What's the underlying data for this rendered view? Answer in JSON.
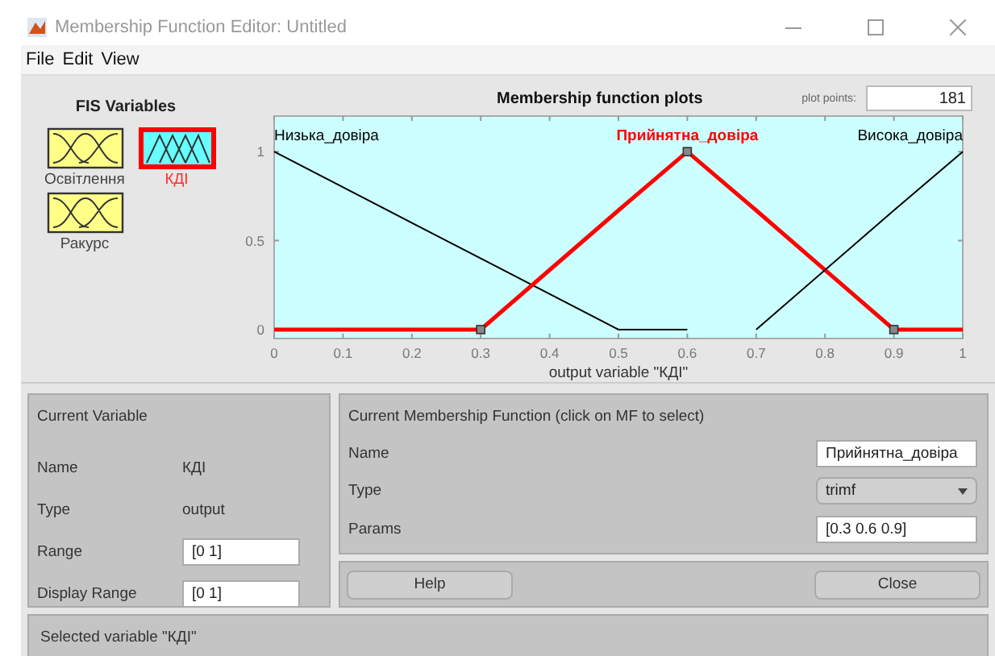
{
  "window": {
    "title": "Membership Function Editor: Untitled"
  },
  "menu": [
    "File",
    "Edit",
    "View"
  ],
  "fis_variables": {
    "title": "FIS Variables",
    "items": [
      {
        "name": "Освітлення",
        "kind": "input",
        "selected": false
      },
      {
        "name": "КДІ",
        "kind": "output",
        "selected": true
      },
      {
        "name": "Ракурс",
        "kind": "input",
        "selected": false
      }
    ]
  },
  "plot": {
    "title": "Membership function plots",
    "mf_states": [
      {
        "selected": false
      },
      {
        "selected": true
      },
      {
        "selected": false
      }
    ],
    "plot_points_label": "plot points:",
    "plot_points": "181",
    "chart_data": {
      "type": "line",
      "xlabel": "output variable \"КДІ\"",
      "x": [
        0,
        0.3,
        0.5,
        0.6,
        0.7,
        0.9,
        1
      ],
      "series": [
        {
          "name": "Низька_довіра",
          "color": "#000000",
          "values": [
            1,
            0.4,
            0,
            0,
            null,
            null,
            null
          ]
        },
        {
          "name": "Прийнятна_довіра",
          "color": "#ff0000",
          "values": [
            0,
            0,
            0.67,
            1,
            0.67,
            0,
            0
          ]
        },
        {
          "name": "Висока_довіра",
          "color": "#000000",
          "values": [
            null,
            null,
            null,
            null,
            0,
            0.67,
            1
          ]
        }
      ],
      "xlim": [
        0,
        1
      ],
      "ylim": [
        -0.05,
        1.2
      ],
      "xticks": [
        0,
        0.1,
        0.2,
        0.3,
        0.4,
        0.5,
        0.6,
        0.7,
        0.8,
        0.9,
        1
      ],
      "yticks": [
        0,
        0.5,
        1
      ]
    }
  },
  "current_variable": {
    "title": "Current Variable",
    "fields": [
      {
        "label": "Name",
        "value": "КДІ",
        "kind": "text"
      },
      {
        "label": "Type",
        "value": "output",
        "kind": "text"
      },
      {
        "label": "Range",
        "value": "[0 1]",
        "kind": "input"
      },
      {
        "label": "Display Range",
        "value": "[0 1]",
        "kind": "input"
      }
    ]
  },
  "current_mf": {
    "title": "Current Membership Function (click on MF to select)",
    "name_label": "Name",
    "name": "Прийнятна_довіра",
    "type_label": "Type",
    "type": "trimf",
    "params_label": "Params",
    "params": "[0.3 0.6 0.9]"
  },
  "buttons": [
    "Help",
    "Close"
  ],
  "status": "Selected variable \"КДІ\""
}
